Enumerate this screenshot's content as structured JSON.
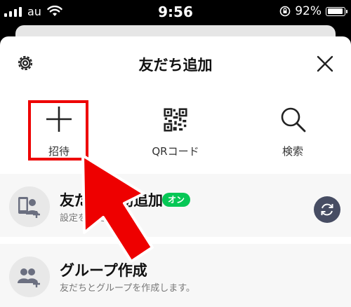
{
  "status_bar": {
    "carrier": "au",
    "time": "9:56",
    "battery_percent": "92%",
    "battery_level": 0.92
  },
  "sheet": {
    "title": "友だち追加",
    "settings_icon": "gear-icon",
    "close_icon": "close-icon"
  },
  "actions": {
    "invite_label": "招待",
    "qr_label": "QRコード",
    "search_label": "検索"
  },
  "rows": {
    "auto_add_title": "友だち自動追加",
    "auto_add_badge": "オン",
    "auto_add_sub": "設定を変更",
    "group_title": "グループ作成",
    "group_sub": "友だちとグループを作成します。"
  },
  "colors": {
    "accent_green": "#06c755",
    "annotation_red": "#e00000",
    "refresh_button": "#474d63"
  }
}
